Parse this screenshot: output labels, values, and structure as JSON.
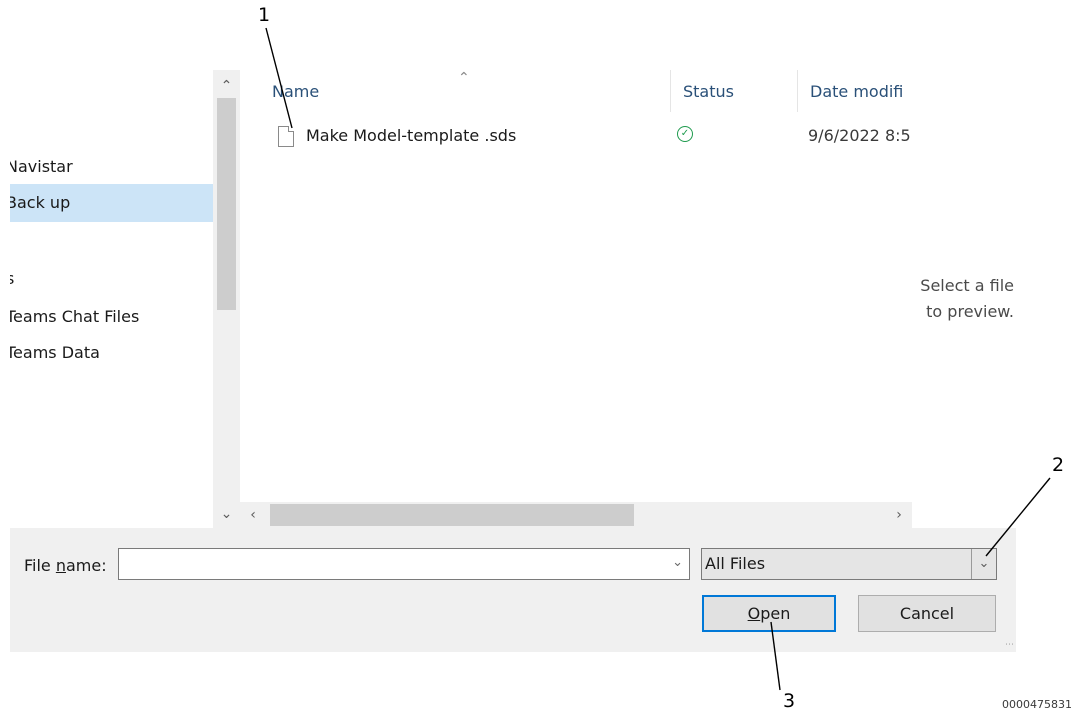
{
  "sidebar": {
    "items": [
      {
        "label": "Navistar",
        "selected": false
      },
      {
        "label": "Back up",
        "selected": true
      },
      {
        "label": "s",
        "selected": false
      },
      {
        "label": "Teams Chat Files",
        "selected": false
      },
      {
        "label": "Teams Data",
        "selected": false
      }
    ]
  },
  "file_list": {
    "columns": [
      "Name",
      "Status",
      "Date modifi"
    ],
    "rows": [
      {
        "name": "Make Model-template .sds",
        "status_icon": "synced-check-icon",
        "date": "9/6/2022 8:5"
      }
    ]
  },
  "preview": {
    "line1": "Select a file",
    "line2": "to preview."
  },
  "bottom": {
    "file_name_label_prefix": "File ",
    "file_name_label_access": "n",
    "file_name_label_suffix": "ame:",
    "file_name_value": "",
    "filter_value": "All Files",
    "open_access": "O",
    "open_rest": "pen",
    "cancel_label": "Cancel"
  },
  "callouts": {
    "c1": "1",
    "c2": "2",
    "c3": "3"
  },
  "figure_code": "0000475831",
  "colors": {
    "selection": "#cce4f7",
    "accent": "#0078d7",
    "status_ok": "#1f9b4e",
    "header_text": "#2a5078"
  }
}
